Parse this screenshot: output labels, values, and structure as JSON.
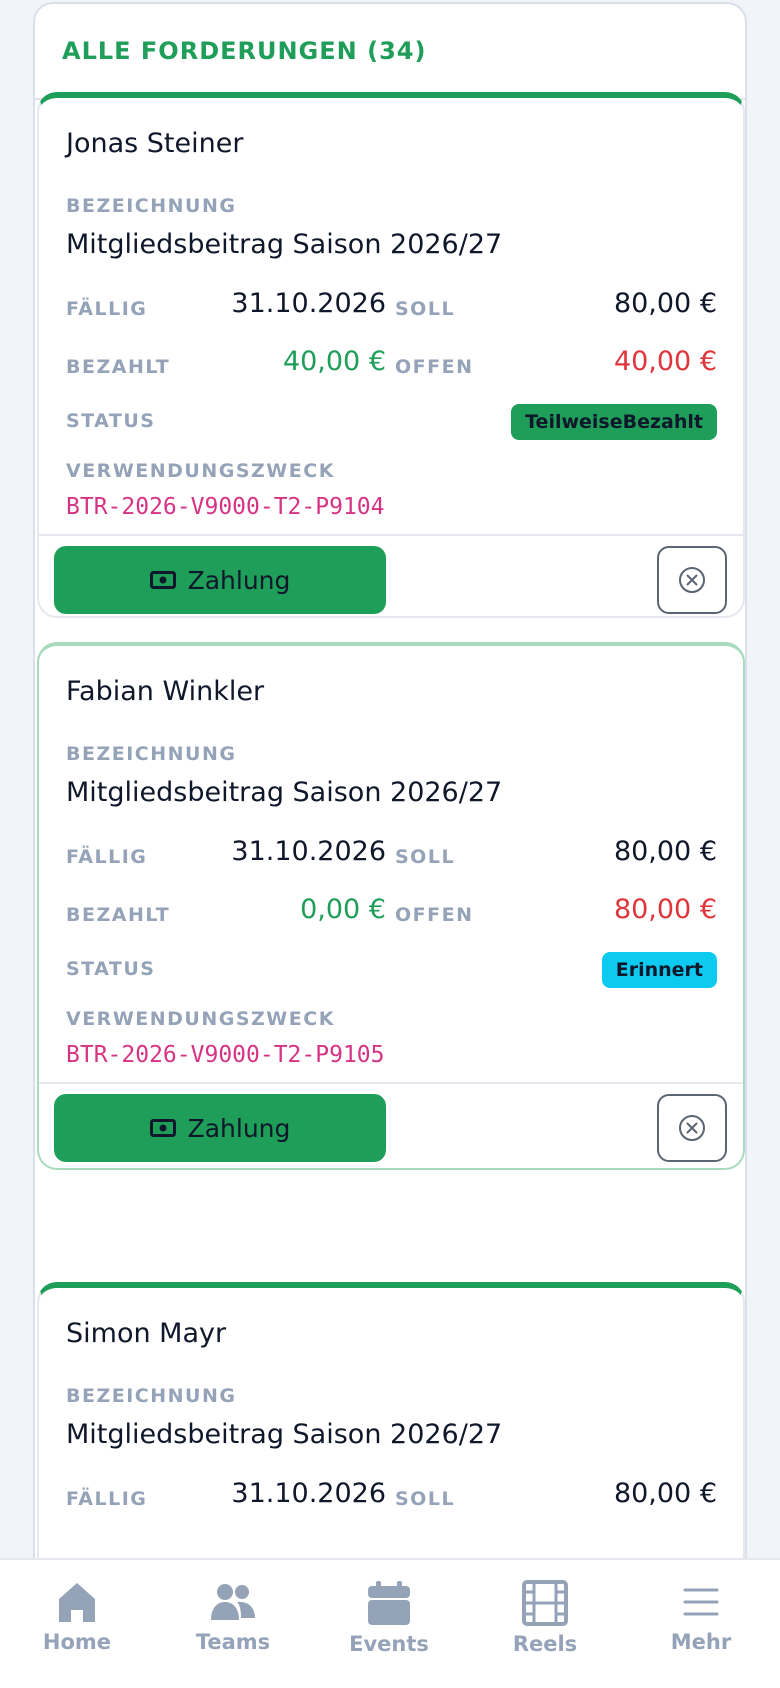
{
  "header": {
    "title": "ALLE FORDERUNGEN (34)"
  },
  "labels": {
    "bezeichnung": "BEZEICHNUNG",
    "faellig": "FÄLLIG",
    "soll": "SOLL",
    "bezahlt": "BEZAHLT",
    "offen": "OFFEN",
    "status": "STATUS",
    "verwendungszweck": "VERWENDUNGSZWECK",
    "pay_button": "Zahlung"
  },
  "cards": [
    {
      "name": "Jonas Steiner",
      "bezeichnung": "Mitgliedsbeitrag Saison 2026/27",
      "faellig": "31.10.2026",
      "soll": "80,00 €",
      "bezahlt": "40,00 €",
      "offen": "40,00 €",
      "status": "TeilweiseBezahlt",
      "status_color": "#1e9e59",
      "verwendungszweck": "BTR-2026-V9000-T2-P9104"
    },
    {
      "name": "Fabian Winkler",
      "bezeichnung": "Mitgliedsbeitrag Saison 2026/27",
      "faellig": "31.10.2026",
      "soll": "80,00 €",
      "bezahlt": "0,00 €",
      "offen": "80,00 €",
      "status": "Erinnert",
      "status_color": "#0dcaf0",
      "verwendungszweck": "BTR-2026-V9000-T2-P9105"
    },
    {
      "name": "Simon Mayr",
      "bezeichnung": "Mitgliedsbeitrag Saison 2026/27",
      "faellig": "31.10.2026",
      "soll": "80,00 €"
    }
  ],
  "nav": [
    {
      "label": "Home",
      "icon": "home-icon"
    },
    {
      "label": "Teams",
      "icon": "users-icon"
    },
    {
      "label": "Events",
      "icon": "calendar-icon"
    },
    {
      "label": "Reels",
      "icon": "film-icon"
    },
    {
      "label": "Mehr",
      "icon": "menu-icon"
    }
  ],
  "colors": {
    "accent": "#1e9e59",
    "danger": "#e0353b",
    "muted": "#94a3b8",
    "reference": "#d63384",
    "info": "#0dcaf0"
  }
}
